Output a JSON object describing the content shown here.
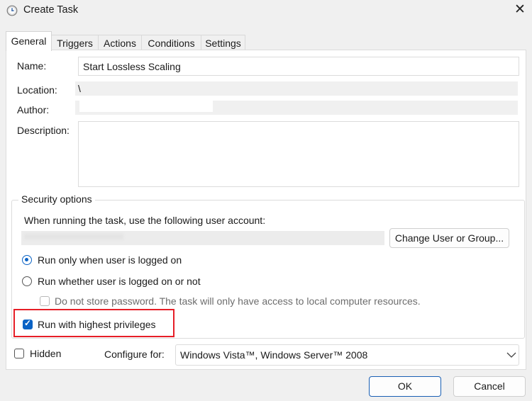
{
  "window": {
    "title": "Create Task",
    "close_symbol": "✕"
  },
  "tabs": [
    "General",
    "Triggers",
    "Actions",
    "Conditions",
    "Settings"
  ],
  "general": {
    "name_label": "Name:",
    "name_value": "Start Lossless Scaling",
    "location_label": "Location:",
    "location_value": "\\",
    "author_label": "Author:",
    "author_value": "",
    "description_label": "Description:",
    "description_value": ""
  },
  "security": {
    "group_title": "Security options",
    "account_prompt": "When running the task, use the following user account:",
    "account_value": "",
    "change_user_button": "Change User or Group...",
    "radio_logged_on": "Run only when user is logged on",
    "radio_logged_on_checked": true,
    "radio_whether": "Run whether user is logged on or not",
    "radio_whether_checked": false,
    "do_not_store": "Do not store password.  The task will only have access to local computer resources.",
    "do_not_store_checked": false,
    "highest_privileges": "Run with highest privileges",
    "highest_privileges_checked": true
  },
  "bottom": {
    "hidden_label": "Hidden",
    "hidden_checked": false,
    "configure_label": "Configure for:",
    "configure_value": "Windows Vista™, Windows Server™ 2008"
  },
  "buttons": {
    "ok": "OK",
    "cancel": "Cancel"
  },
  "colors": {
    "accent": "#0b63c5",
    "highlight_border": "#e61e27"
  }
}
